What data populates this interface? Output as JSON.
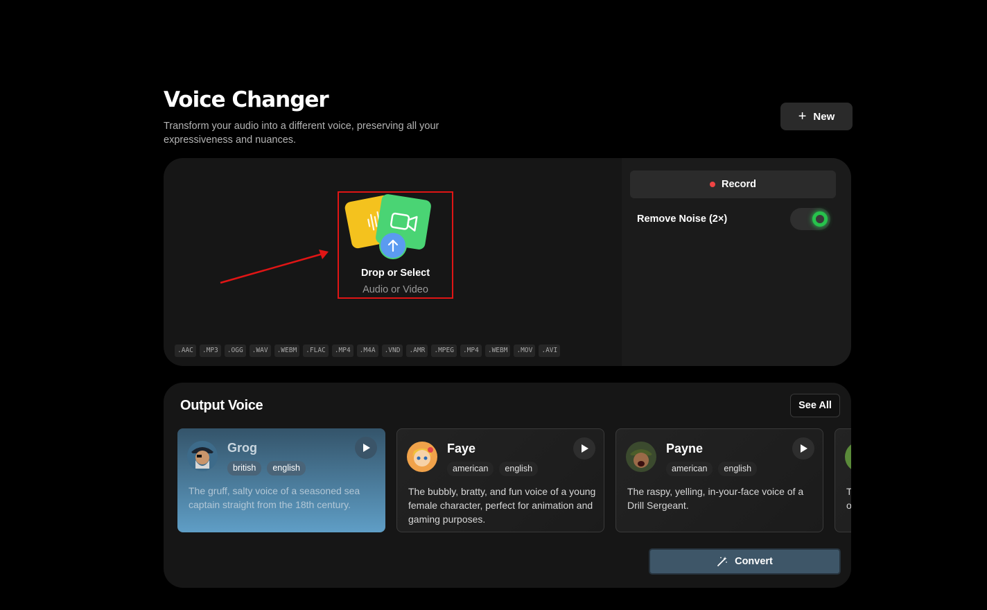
{
  "header": {
    "title": "Voice Changer",
    "subtitle": "Transform your audio into a different voice, preserving all your expressiveness and nuances.",
    "new_label": "New"
  },
  "upload": {
    "drop_title": "Drop or Select",
    "drop_subtitle": "Audio or Video",
    "formats": [
      ".AAC",
      ".MP3",
      ".OGG",
      ".WAV",
      ".WEBM",
      ".FLAC",
      ".MP4",
      ".M4A",
      ".VND",
      ".AMR",
      ".MPEG",
      ".MP4",
      ".WEBM",
      ".MOV",
      ".AVI"
    ]
  },
  "controls": {
    "record_label": "Record",
    "remove_noise_label": "Remove Noise (2×)",
    "remove_noise_enabled": true
  },
  "output_voice": {
    "title": "Output Voice",
    "see_all_label": "See All",
    "voices": [
      {
        "name": "Grog",
        "tags": [
          "british",
          "english"
        ],
        "description": "The gruff, salty voice of a seasoned sea captain straight from the 18th century.",
        "selected": true
      },
      {
        "name": "Faye",
        "tags": [
          "american",
          "english"
        ],
        "description": "The bubbly, bratty, and fun voice of a young female character, perfect for animation and gaming purposes.",
        "selected": false
      },
      {
        "name": "Payne",
        "tags": [
          "american",
          "english"
        ],
        "description": "The raspy, yelling, in-your-face voice of a Drill Sergeant.",
        "selected": false
      },
      {
        "name": "",
        "tags": [],
        "description": "T o",
        "selected": false
      }
    ]
  },
  "actions": {
    "convert_label": "Convert"
  },
  "colors": {
    "background": "#000000",
    "panel": "#161616",
    "accent_record": "#ef4444",
    "toggle_on": "#27c24c",
    "selected_card": "#5f9ec6",
    "annotation": "#e01515"
  }
}
